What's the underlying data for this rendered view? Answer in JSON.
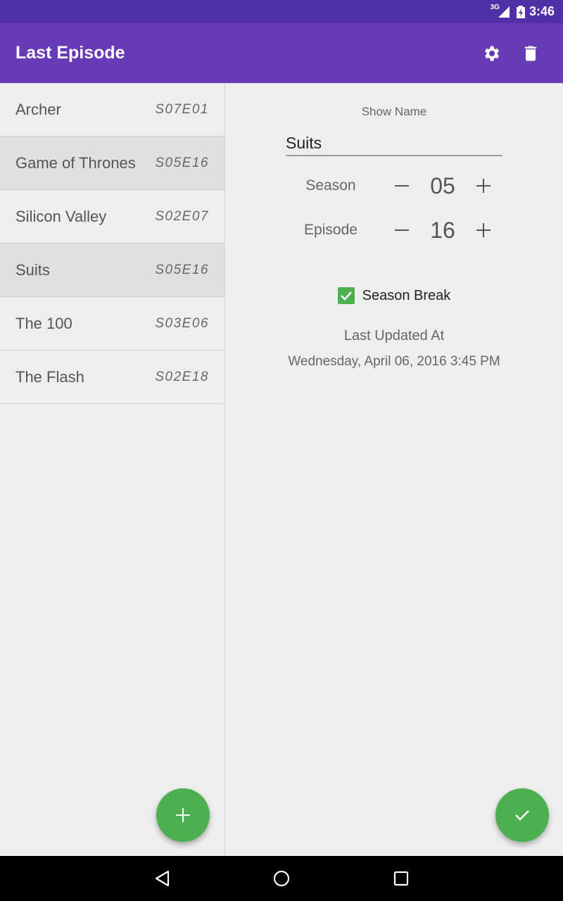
{
  "status_bar": {
    "network": "3G",
    "time": "3:46"
  },
  "app_bar": {
    "title": "Last Episode",
    "actions": [
      "settings-icon",
      "delete-icon"
    ]
  },
  "shows": [
    {
      "name": "Archer",
      "code": "S07E01"
    },
    {
      "name": "Game of Thrones",
      "code": "S05E16"
    },
    {
      "name": "Silicon Valley",
      "code": "S02E07"
    },
    {
      "name": "Suits",
      "code": "S05E16"
    },
    {
      "name": "The 100",
      "code": "S03E06"
    },
    {
      "name": "The Flash",
      "code": "S02E18"
    }
  ],
  "detail": {
    "show_name_label": "Show Name",
    "show_name_value": "Suits",
    "season_label": "Season",
    "season_value": "05",
    "episode_label": "Episode",
    "episode_value": "16",
    "season_break_label": "Season Break",
    "season_break_checked": true,
    "last_updated_label": "Last Updated At",
    "last_updated_value": "Wednesday, April 06, 2016 3:45 PM"
  },
  "colors": {
    "status_bar": "#5030a8",
    "app_bar": "#673ab7",
    "accent": "#4caf50",
    "background": "#eeeeee"
  }
}
